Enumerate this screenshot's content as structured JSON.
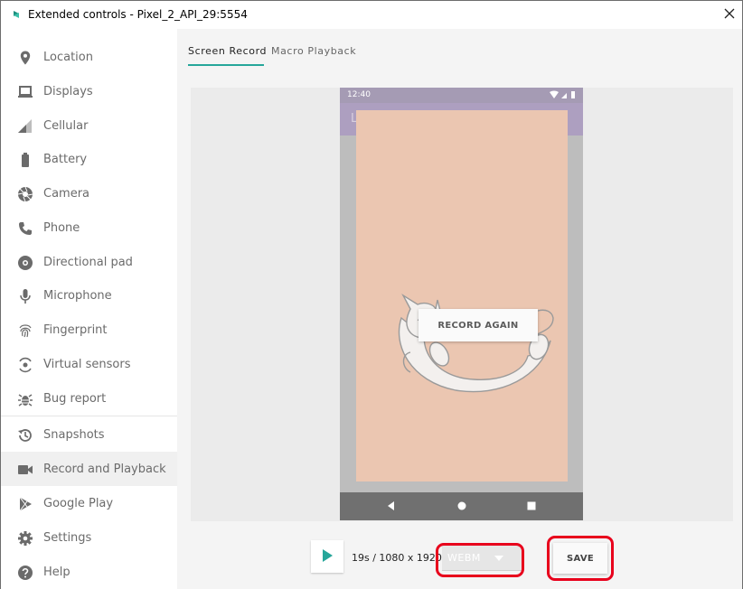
{
  "window": {
    "title": "Extended controls - Pixel_2_API_29:5554"
  },
  "sidebar": {
    "items": [
      {
        "label": "Location",
        "icon": "location-pin-icon"
      },
      {
        "label": "Displays",
        "icon": "display-icon"
      },
      {
        "label": "Cellular",
        "icon": "cellular-signal-icon"
      },
      {
        "label": "Battery",
        "icon": "battery-icon"
      },
      {
        "label": "Camera",
        "icon": "camera-aperture-icon"
      },
      {
        "label": "Phone",
        "icon": "phone-icon"
      },
      {
        "label": "Directional pad",
        "icon": "dpad-icon"
      },
      {
        "label": "Microphone",
        "icon": "microphone-icon"
      },
      {
        "label": "Fingerprint",
        "icon": "fingerprint-icon"
      },
      {
        "label": "Virtual sensors",
        "icon": "virtual-sensors-icon"
      },
      {
        "label": "Bug report",
        "icon": "bug-icon"
      },
      {
        "label": "Snapshots",
        "icon": "history-icon"
      },
      {
        "label": "Record and Playback",
        "icon": "videocam-icon",
        "active": true
      },
      {
        "label": "Google Play",
        "icon": "google-play-icon"
      },
      {
        "label": "Settings",
        "icon": "gear-icon"
      },
      {
        "label": "Help",
        "icon": "help-icon"
      }
    ]
  },
  "tabs": [
    {
      "label": "Screen Record",
      "active": true
    },
    {
      "label": "Macro Playback",
      "active": false
    }
  ],
  "phone": {
    "time": "12:40",
    "appbar_letter": "L",
    "record_again_label": "RECORD AGAIN"
  },
  "controls": {
    "recording_info": "19s / 1080 x 1920",
    "format_value": "WEBM",
    "save_label": "SAVE"
  },
  "colors": {
    "accent": "#26a69a",
    "highlight": "#e8001c",
    "phone_overlay": "#ebc6b1",
    "statusbar": "#a59bb4"
  }
}
